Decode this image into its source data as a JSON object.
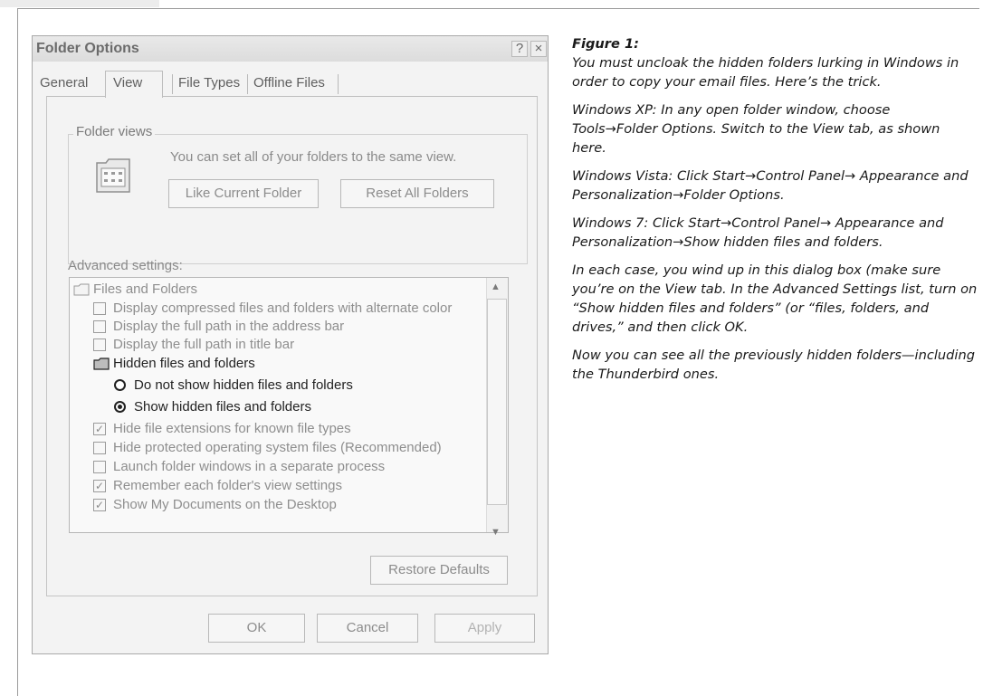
{
  "dialog": {
    "title": "Folder Options",
    "help_glyph": "?",
    "close_glyph": "×",
    "tabs": [
      "General",
      "View",
      "File Types",
      "Offline Files"
    ],
    "active_tab": "View",
    "folder_views": {
      "group_label": "Folder views",
      "description": "You can set all of your folders to the same view.",
      "like_current_label": "Like Current Folder",
      "reset_all_label": "Reset All Folders"
    },
    "advanced": {
      "label": "Advanced settings:",
      "items": [
        {
          "type": "folder",
          "label": "Files and Folders"
        },
        {
          "type": "checkbox",
          "checked": false,
          "label": "Display compressed files and folders with alternate color"
        },
        {
          "type": "checkbox",
          "checked": false,
          "label": "Display the full path in the address bar"
        },
        {
          "type": "checkbox",
          "checked": false,
          "label": "Display the full path in title bar"
        },
        {
          "type": "folder",
          "label": "Hidden files and folders"
        },
        {
          "type": "radio",
          "checked": false,
          "label": "Do not show hidden files and folders"
        },
        {
          "type": "radio",
          "checked": true,
          "label": "Show hidden files and folders"
        },
        {
          "type": "checkbox",
          "checked": true,
          "label": "Hide file extensions for known file types"
        },
        {
          "type": "checkbox",
          "checked": false,
          "label": "Hide protected operating system files (Recommended)"
        },
        {
          "type": "checkbox",
          "checked": false,
          "label": "Launch folder windows in a separate process"
        },
        {
          "type": "checkbox",
          "checked": true,
          "label": "Remember each folder's view settings"
        },
        {
          "type": "checkbox",
          "checked": true,
          "label": "Show My Documents on the Desktop"
        }
      ],
      "scroll_up_glyph": "▲",
      "scroll_down_glyph": "▼"
    },
    "restore_defaults_label": "Restore Defaults",
    "ok_label": "OK",
    "cancel_label": "Cancel",
    "apply_label": "Apply"
  },
  "caption": {
    "title": "Figure 1:",
    "p1": "You must uncloak the hidden folders lurking in Windows in order to copy your email files. Here’s the trick.",
    "p2": "Windows XP: In any open folder window, choose Tools→Folder Options. Switch to the View tab, as shown here.",
    "p3": "Windows Vista: Click Start→Control Panel→ Appearance and Personalization→Folder Options.",
    "p4": "Windows 7: Click Start→Control Panel→ Appearance and Personalization→Show hidden files and folders.",
    "p5": " In each case, you wind up in this dialog box (make sure you’re on the View tab. In the Advanced Settings list, turn on “Show hidden files and folders” (or “files, folders, and drives,” and then click OK.",
    "p6": "Now you can see all the previously hidden fold­ers—including the Thunderbird ones."
  }
}
